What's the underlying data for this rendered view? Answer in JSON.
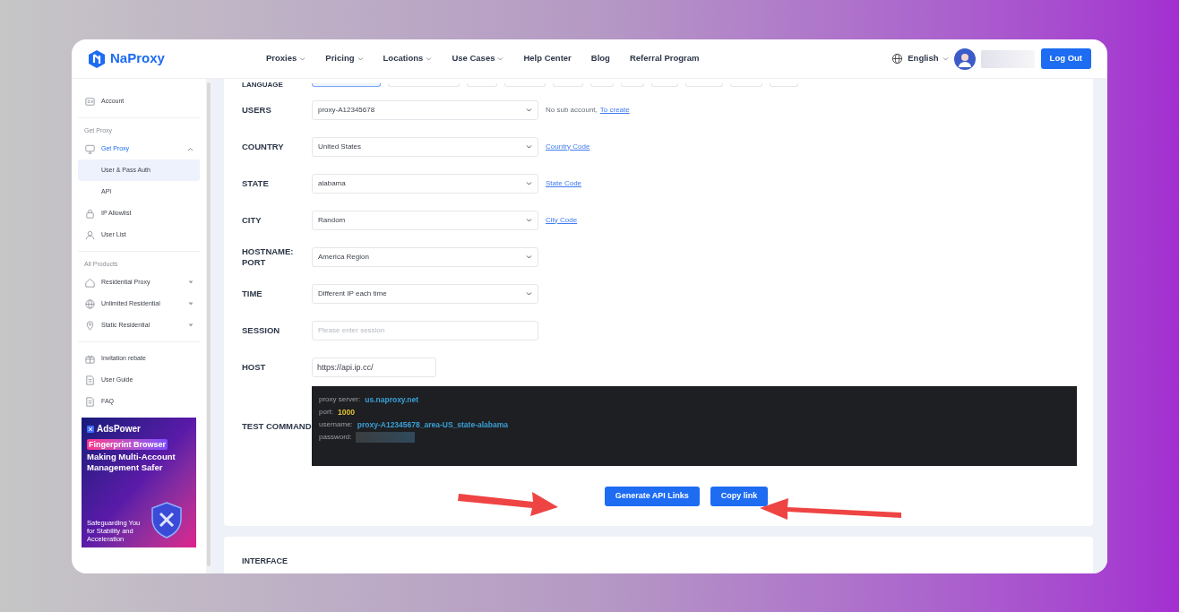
{
  "nav": {
    "logo": "NaProxy",
    "menu": [
      {
        "label": "Proxies",
        "dropdown": true
      },
      {
        "label": "Pricing",
        "dropdown": true
      },
      {
        "label": "Locations",
        "dropdown": true
      },
      {
        "label": "Use Cases",
        "dropdown": true
      },
      {
        "label": "Help Center",
        "dropdown": false
      },
      {
        "label": "Blog",
        "dropdown": false
      },
      {
        "label": "Referral Program",
        "dropdown": false
      }
    ],
    "language": "English",
    "logout": "Log Out"
  },
  "sidebar": {
    "groups": [
      {
        "items": [
          {
            "label": "Account",
            "selected": false
          }
        ]
      },
      {
        "title": "Get Proxy",
        "items": [
          {
            "label": "Get Proxy",
            "selected": false,
            "expanded": true,
            "children": [
              {
                "label": "User & Pass Auth",
                "selected": true
              },
              {
                "label": "API",
                "selected": false
              }
            ]
          },
          {
            "label": "IP Allowlist",
            "selected": false
          },
          {
            "label": "User List",
            "selected": false
          }
        ]
      },
      {
        "title": "All Products",
        "items": [
          {
            "label": "Residential Proxy",
            "selected": false,
            "expanded": false
          },
          {
            "label": "Unlimited Residential",
            "selected": false,
            "expanded": false
          },
          {
            "label": "Static Residential",
            "selected": false,
            "expanded": false
          }
        ]
      },
      {
        "items": [
          {
            "label": "Invitation rebate",
            "selected": false
          },
          {
            "label": "User Guide",
            "selected": false
          },
          {
            "label": "FAQ",
            "selected": false
          }
        ]
      }
    ],
    "ad": {
      "brand": "AdsPower",
      "badge": "Fingerprint Browser",
      "headline": "Making Multi-Account Management Safer",
      "tagline": "Safeguarding You for Stability and Acceleration"
    }
  },
  "form": {
    "language": {
      "label": "LANGUAGE",
      "options": [
        {
          "selected": true
        },
        {
          "selected": false
        },
        {
          "selected": false
        },
        {
          "selected": false
        },
        {
          "selected": false
        },
        {
          "selected": false
        },
        {
          "selected": false
        },
        {
          "selected": false
        },
        {
          "selected": false
        },
        {
          "selected": false
        },
        {
          "selected": false
        }
      ]
    },
    "rows": [
      {
        "kind": "select",
        "label": "USERS",
        "value": "proxy-A12345678",
        "note": "No sub account,",
        "link": "To create"
      },
      {
        "kind": "select",
        "label": "COUNTRY",
        "value": "United States",
        "link": "Country Code"
      },
      {
        "kind": "select",
        "label": "STATE",
        "value": "alabama",
        "link": "State Code"
      },
      {
        "kind": "select",
        "label": "CITY",
        "value": "Random",
        "link": "City Code"
      },
      {
        "kind": "select",
        "label": "HOSTNAME: PORT",
        "value": "America Region"
      },
      {
        "kind": "select",
        "label": "TIME",
        "value": "Different IP each time"
      },
      {
        "kind": "input",
        "label": "SESSION",
        "placeholder": "Please enter session"
      },
      {
        "kind": "url",
        "label": "HOST",
        "value": "https://api.ip.cc/"
      }
    ],
    "test_command": {
      "label": "TEST COMMAND",
      "lines": [
        {
          "key": "proxy server:",
          "value": "us.naproxy.net",
          "color": "#3a9fd6"
        },
        {
          "key": "port:",
          "value": "1000",
          "color": "#e0c234"
        },
        {
          "key": "username:",
          "value": "proxy-A12345678_area-US_state-alabama",
          "color": "#3a9fd6"
        },
        {
          "key": "password:"
        }
      ]
    },
    "buttons": [
      "Generate API Links",
      "Copy link"
    ]
  },
  "next_section": {
    "label": "INTERFACE"
  }
}
